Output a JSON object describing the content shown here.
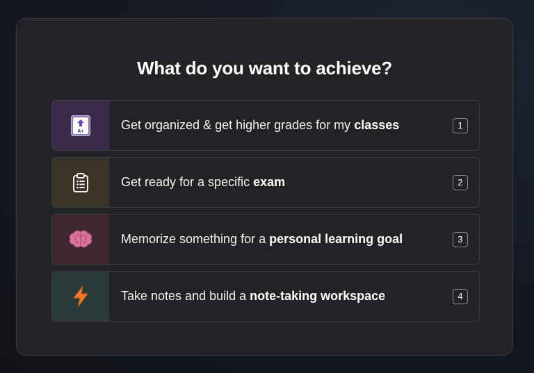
{
  "heading": "What do you want to achieve?",
  "options": [
    {
      "text": "Get organized & get higher grades for my ",
      "bold": "classes",
      "key": "1",
      "icon": "grade-report-icon",
      "icon_bg": "#3a2b4a"
    },
    {
      "text": "Get ready for a specific ",
      "bold": "exam",
      "key": "2",
      "icon": "clipboard-icon",
      "icon_bg": "#3a3428"
    },
    {
      "text": "Memorize something for a ",
      "bold": "personal learning goal",
      "key": "3",
      "icon": "brain-icon",
      "icon_bg": "#3c282e"
    },
    {
      "text": "Take notes and build a ",
      "bold": "note-taking workspace",
      "key": "4",
      "icon": "lightning-icon",
      "icon_bg": "#2a3a38"
    }
  ],
  "icon_text": {
    "grade": "A+"
  }
}
